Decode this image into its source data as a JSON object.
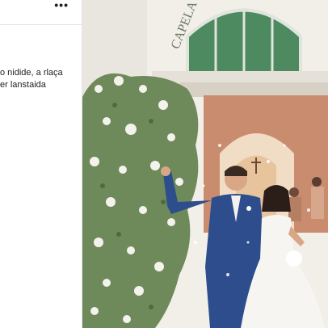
{
  "post": {
    "more_label": "•••",
    "caption_lines": [
      "o nidide, a rlaça",
      "er lanstaida"
    ]
  },
  "photo": {
    "sign_text": "CAPELA",
    "colors": {
      "door_green": "#4d8a5f",
      "wall": "#f2efe9",
      "suit": "#2d4d8c",
      "dress": "#f7f5f2",
      "foliage": "#6f8a5a"
    }
  }
}
